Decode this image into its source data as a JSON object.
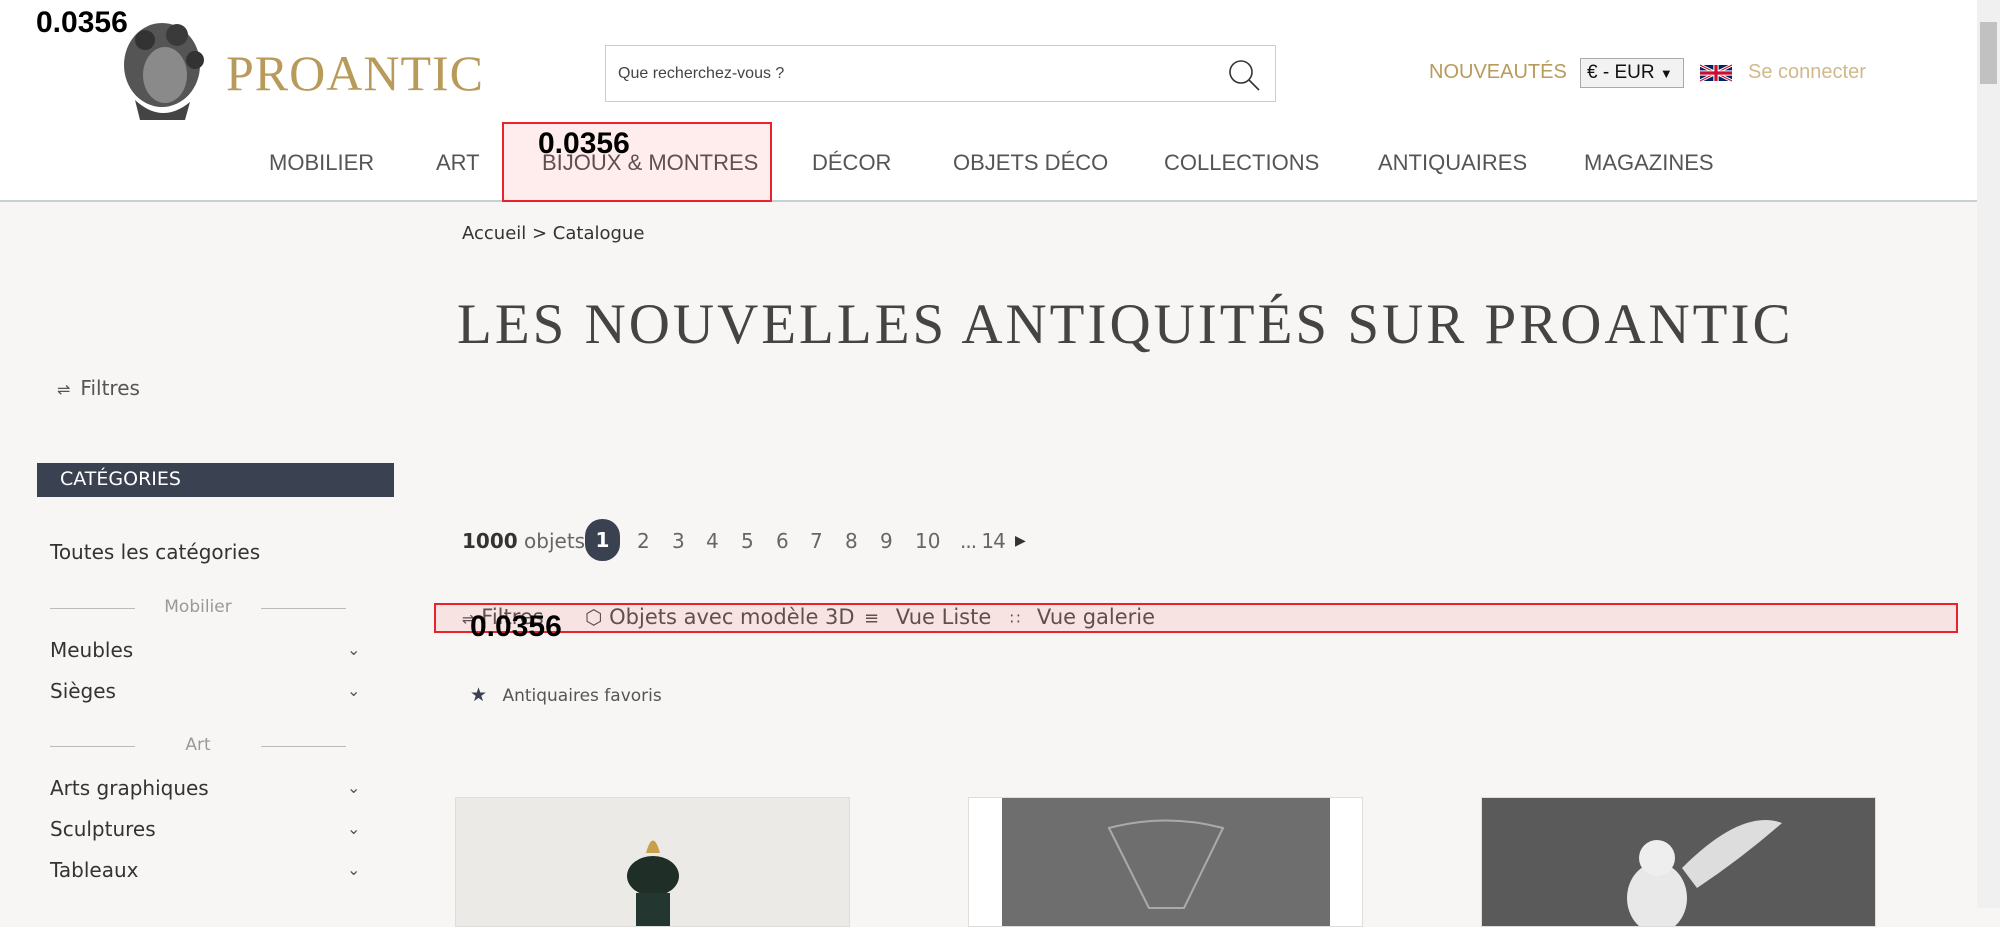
{
  "header": {
    "brand": "PROANTIC",
    "search_placeholder": "Que recherchez-vous ?",
    "nouveautes": "NOUVEAUTÉS",
    "currency": "€ - EUR",
    "login": "Se connecter"
  },
  "nav": [
    "MOBILIER",
    "ART",
    "BIJOUX & MONTRES",
    "DÉCOR",
    "OBJETS DÉCO",
    "COLLECTIONS",
    "ANTIQUAIRES",
    "MAGAZINES"
  ],
  "overlay": {
    "label_top": "0.0356",
    "label_nav": "0.0356",
    "label_toolbar": "0.0356"
  },
  "breadcrumb": "Accueil > Catalogue",
  "title": "LES NOUVELLES ANTIQUITÉS SUR PROANTIC",
  "sidebar": {
    "filters": "Filtres",
    "categories_header": "CATÉGORIES",
    "all": "Toutes les catégories",
    "group_mobilier": "Mobilier",
    "meubles": "Meubles",
    "sieges": "Sièges",
    "group_art": "Art",
    "arts_graphiques": "Arts graphiques",
    "sculptures": "Sculptures",
    "tableaux": "Tableaux"
  },
  "results": {
    "count": "1000",
    "count_label": "objets",
    "pages": [
      "1",
      "2",
      "3",
      "4",
      "5",
      "6",
      "7",
      "8",
      "9",
      "10",
      "... 14"
    ]
  },
  "toolbar": {
    "filters": "Filtres",
    "model3d": "Objets avec modèle 3D",
    "list": "Vue Liste",
    "gallery": "Vue galerie"
  },
  "favorites": "Antiquaires favoris"
}
